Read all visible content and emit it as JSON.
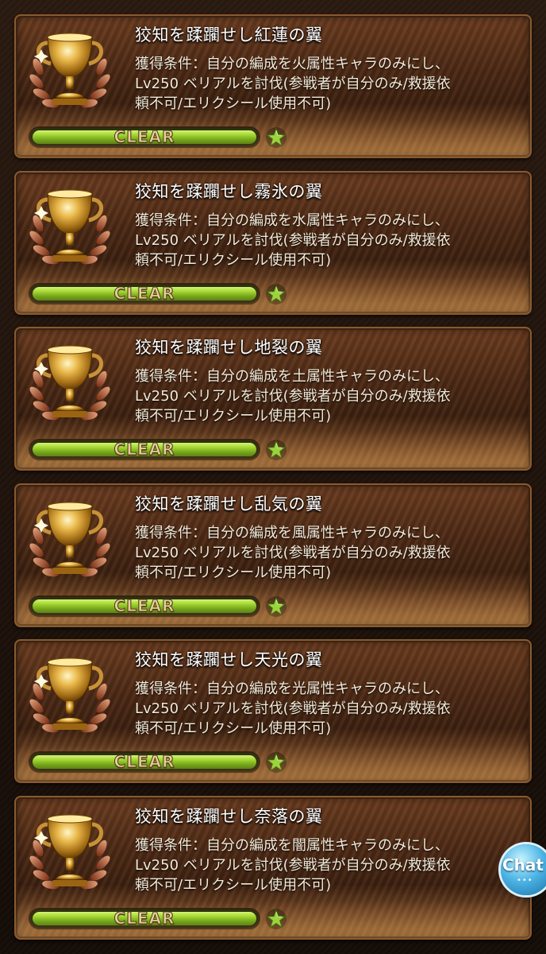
{
  "progress_label": "CLEAR",
  "progress_fraction": 1.0,
  "star_icon": "star-icon",
  "trophy_icon": "gold-trophy-icon",
  "colors": {
    "bar_fill": "#9ae02c",
    "card_border": "#8a5a2e",
    "title_text": "#ffffff"
  },
  "trophies": [
    {
      "title": "狡知を蹂躙せし紅蓮の翼",
      "desc_line1": "獲得条件：自分の編成を火属性キャラのみにし、",
      "desc_line2": "Lv250 ベリアルを討伐(参戦者が自分のみ/救援依",
      "desc_line3": "頼不可/エリクシール使用不可)"
    },
    {
      "title": "狡知を蹂躙せし霧氷の翼",
      "desc_line1": "獲得条件：自分の編成を水属性キャラのみにし、",
      "desc_line2": "Lv250 ベリアルを討伐(参戦者が自分のみ/救援依",
      "desc_line3": "頼不可/エリクシール使用不可)"
    },
    {
      "title": "狡知を蹂躙せし地裂の翼",
      "desc_line1": "獲得条件：自分の編成を土属性キャラのみにし、",
      "desc_line2": "Lv250 ベリアルを討伐(参戦者が自分のみ/救援依",
      "desc_line3": "頼不可/エリクシール使用不可)"
    },
    {
      "title": "狡知を蹂躙せし乱気の翼",
      "desc_line1": "獲得条件：自分の編成を風属性キャラのみにし、",
      "desc_line2": "Lv250 ベリアルを討伐(参戦者が自分のみ/救援依",
      "desc_line3": "頼不可/エリクシール使用不可)"
    },
    {
      "title": "狡知を蹂躙せし天光の翼",
      "desc_line1": "獲得条件：自分の編成を光属性キャラのみにし、",
      "desc_line2": "Lv250 ベリアルを討伐(参戦者が自分のみ/救援依",
      "desc_line3": "頼不可/エリクシール使用不可)"
    },
    {
      "title": "狡知を蹂躙せし奈落の翼",
      "desc_line1": "獲得条件：自分の編成を闇属性キャラのみにし、",
      "desc_line2": "Lv250 ベリアルを討伐(参戦者が自分のみ/救援依",
      "desc_line3": "頼不可/エリクシール使用不可)"
    }
  ],
  "chat_button": {
    "label": "Chat",
    "dots": "•••"
  }
}
